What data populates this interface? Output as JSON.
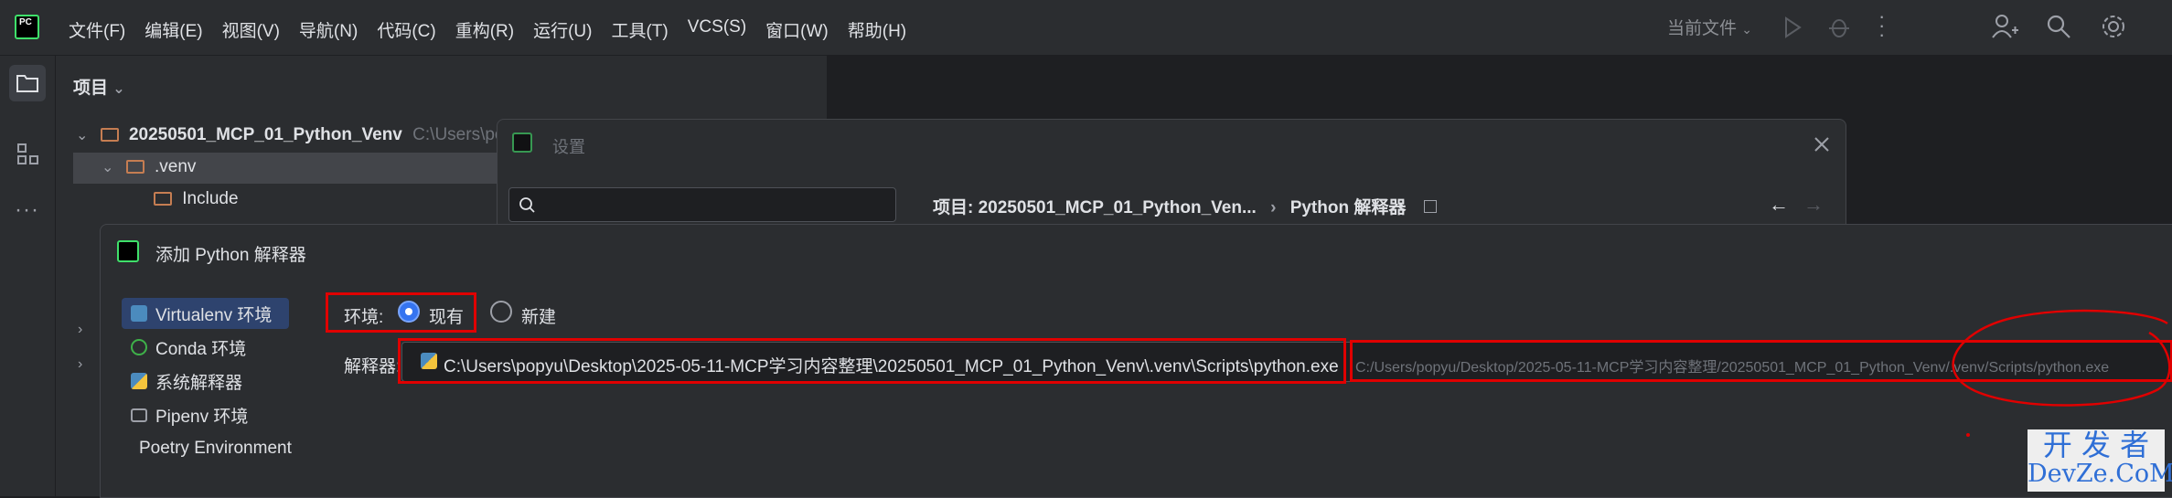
{
  "menu": [
    "文件(F)",
    "编辑(E)",
    "视图(V)",
    "导航(N)",
    "代码(C)",
    "重构(R)",
    "运行(U)",
    "工具(T)",
    "VCS(S)",
    "窗口(W)",
    "帮助(H)"
  ],
  "toolbar": {
    "run_config": "当前文件"
  },
  "logo_text": "PC",
  "project_panel": {
    "header": "项目",
    "root_name": "20250501_MCP_01_Python_Venv",
    "root_path": "C:\\Users\\po",
    "venv": ".venv",
    "include": "Include"
  },
  "settings": {
    "title": "设置",
    "breadcrumb_project": "项目: 20250501_MCP_01_Python_Ven...",
    "breadcrumb_sep": "›",
    "breadcrumb_page": "Python 解释器"
  },
  "add_interpreter": {
    "title": "添加 Python 解释器",
    "sidebar": [
      {
        "label": "Virtualenv 环境",
        "icon": "virtualenv-icon",
        "icon_color": "#4b8bbe"
      },
      {
        "label": "Conda 环境",
        "icon": "conda-icon",
        "icon_color": "#3eb049"
      },
      {
        "label": "系统解释器",
        "icon": "python-icon",
        "icon_color": "#f4c43c"
      },
      {
        "label": "Pipenv 环境",
        "icon": "pipenv-folder-icon",
        "icon_color": "#9da0a8"
      },
      {
        "label": "Poetry Environment",
        "icon": "poetry-icon",
        "icon_color": "#3d7ee0"
      }
    ],
    "env_label": "环境:",
    "env_existing": "现有",
    "env_new": "新建",
    "interpreter_label": "解释器:",
    "interpreter_value": "C:\\Users\\popyu\\Desktop\\2025-05-11-MCP学习内容整理\\20250501_MCP_01_Python_Venv\\.venv\\Scripts\\python.exe",
    "interpreter_hint": "C:/Users/popyu/Desktop/2025-05-11-MCP学习内容整理/20250501_MCP_01_Python_Venv/.venv/Scripts/python.exe"
  },
  "watermark": {
    "line1": "开 发 者",
    "line2": "DevZe.CoM"
  },
  "colors": {
    "accent": "#3574f0",
    "annotation_red": "#e00000",
    "selection": "#2e436e"
  }
}
